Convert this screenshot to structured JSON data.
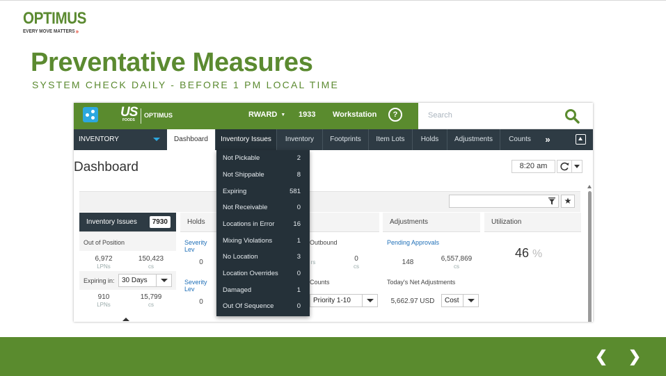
{
  "brand": {
    "name": "OPTIMUS",
    "tagline": "EVERY MOVE MATTERS",
    "tagline_chevrons": "»",
    "color": "#5b8a30",
    "accent": "#e0402c"
  },
  "slide": {
    "title": "Preventative Measures",
    "subtitle": "SYSTEM CHECK DAILY - BEFORE 1 PM LOCAL TIME"
  },
  "app": {
    "header": {
      "logo": "US",
      "logo_sub": "FOODS",
      "product": "OPTIMUS",
      "user": "RWARD",
      "number": "1933",
      "workstation": "Workstation",
      "help": "?",
      "search_placeholder": "Search"
    },
    "nav": {
      "section": "INVENTORY",
      "tabs": [
        "Dashboard",
        "Inventory Issues",
        "Inventory",
        "Footprints",
        "Item Lots",
        "Holds",
        "Adjustments",
        "Counts"
      ],
      "more": "»"
    },
    "page": {
      "title": "Dashboard",
      "time": "8:20 am"
    },
    "cards": {
      "inventory_issues": {
        "title": "Inventory Issues",
        "count": "7930",
        "row1_label": "Out of Position",
        "row1_values": [
          "6,972",
          "150,423"
        ],
        "row1_units": [
          "LPNs",
          "cs"
        ],
        "expiring_label": "Expiring in:",
        "expiring_select": "30 Days",
        "row2_values": [
          "910",
          "15,799"
        ],
        "row2_units": [
          "LPNs",
          "cs"
        ]
      },
      "holds": {
        "title": "Holds",
        "row1_label": "Severity Lev",
        "row1_value": "0",
        "row2_label": "Severity Lev",
        "row2_value": "0"
      },
      "outbound": {
        "row1_label": "Outbound",
        "row1_unit_left": "rs",
        "row1_value": "0",
        "row1_unit": "cs",
        "row2_label": "Counts",
        "row2_select": "Priority 1-10"
      },
      "adjustments": {
        "title": "Adjustments",
        "row1_label": "Pending Approvals",
        "row1_values": [
          "148",
          "6,557,869"
        ],
        "row1_unit": "cs",
        "row2_label": "Today's Net Adjustments",
        "row2_value": "5,662.97 USD",
        "row2_select": "Cost"
      },
      "utilization": {
        "title": "Utilization",
        "value": "46",
        "unit": "%"
      }
    },
    "dropdown": {
      "items": [
        {
          "label": "Not Pickable",
          "count": "2"
        },
        {
          "label": "Not Shippable",
          "count": "8"
        },
        {
          "label": "Expiring",
          "count": "581"
        },
        {
          "label": "Not Receivable",
          "count": "0"
        },
        {
          "label": "Locations in Error",
          "count": "16"
        },
        {
          "label": "Mixing Violations",
          "count": "1"
        },
        {
          "label": "No Location",
          "count": "3"
        },
        {
          "label": "Location Overrides",
          "count": "0"
        },
        {
          "label": "Damaged",
          "count": "1"
        },
        {
          "label": "Out Of Sequence",
          "count": "0"
        }
      ]
    },
    "colors": {
      "header_green": "#5a8b2e",
      "nav_dark": "#2e3b44",
      "app_icon": "#2ca8df",
      "link": "#2070b8"
    }
  },
  "footer": {
    "prev": "❮",
    "next": "❯"
  }
}
